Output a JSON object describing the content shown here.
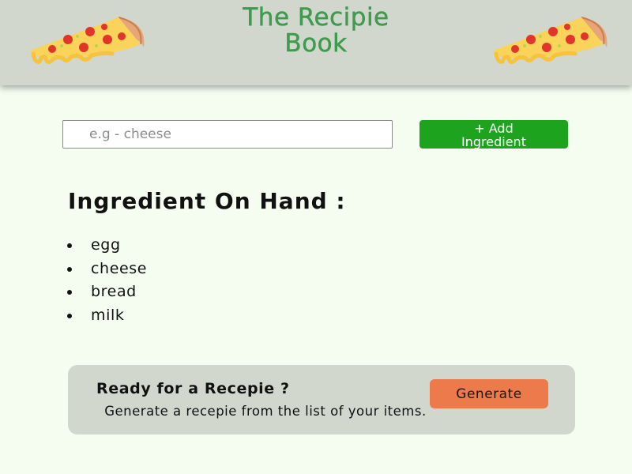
{
  "header": {
    "title_line1": "The Recipie",
    "title_line2": "Book",
    "icon_left": "pizza-slice-icon",
    "icon_right": "pizza-slice-icon"
  },
  "form": {
    "input_placeholder": "e.g - cheese",
    "input_value": "",
    "add_button_line1": "+ Add",
    "add_button_line2": "Ingredient"
  },
  "ingredients": {
    "heading": "Ingredient On Hand :",
    "items": [
      "egg",
      "cheese",
      "bread",
      "milk"
    ]
  },
  "cta": {
    "title": "Ready for a Recepie ?",
    "description": "Generate a recepie from the list of your items.",
    "button_label": "Generate"
  },
  "colors": {
    "header_bg": "#d1d7cd",
    "page_bg": "#f4fdf0",
    "title_green": "#3f9b4e",
    "add_button": "#1ea31e",
    "generate_button": "#ec7a4a"
  }
}
